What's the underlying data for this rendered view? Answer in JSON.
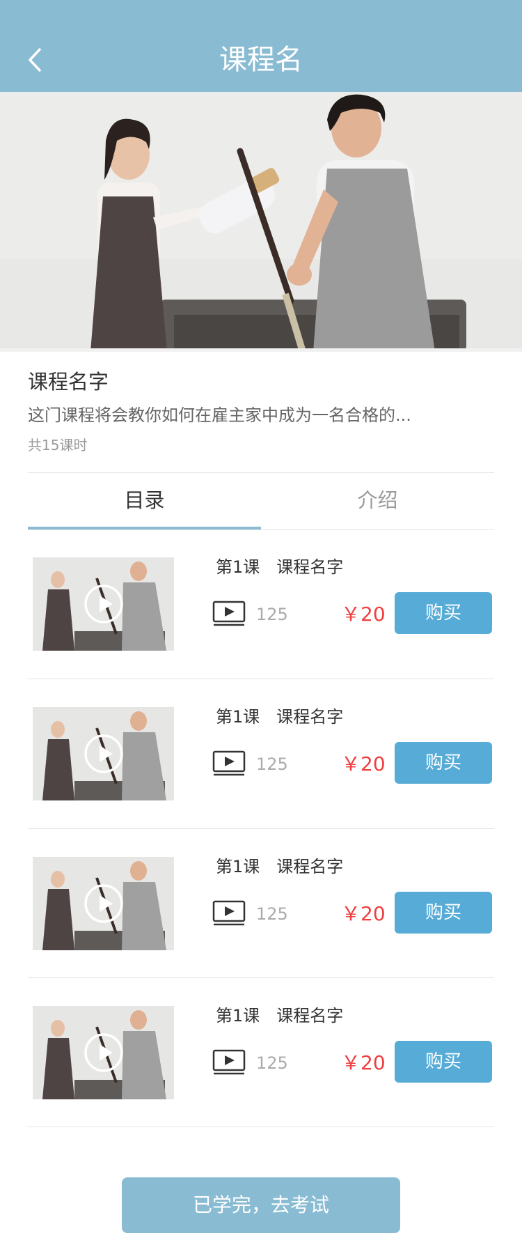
{
  "header": {
    "title": "课程名"
  },
  "course": {
    "name": "课程名字",
    "description": "这门课程将会教你如何在雇主家中成为一名合格的...",
    "lesson_count": "共15课时"
  },
  "tabs": [
    {
      "label": "目录",
      "active": true
    },
    {
      "label": "介绍",
      "active": false
    }
  ],
  "lessons": [
    {
      "title": "第1课　课程名字",
      "views": "125",
      "price": "￥20",
      "button": "购买"
    },
    {
      "title": "第1课　课程名字",
      "views": "125",
      "price": "￥20",
      "button": "购买"
    },
    {
      "title": "第1课　课程名字",
      "views": "125",
      "price": "￥20",
      "button": "购买"
    },
    {
      "title": "第1课　课程名字",
      "views": "125",
      "price": "￥20",
      "button": "购买"
    }
  ],
  "footer": {
    "exam_button": "已学完，去考试"
  },
  "colors": {
    "header_bg": "#89BBD3",
    "buy_button": "#57ACD7",
    "price": "#EE4040",
    "tab_underline": "#89BBD3"
  }
}
